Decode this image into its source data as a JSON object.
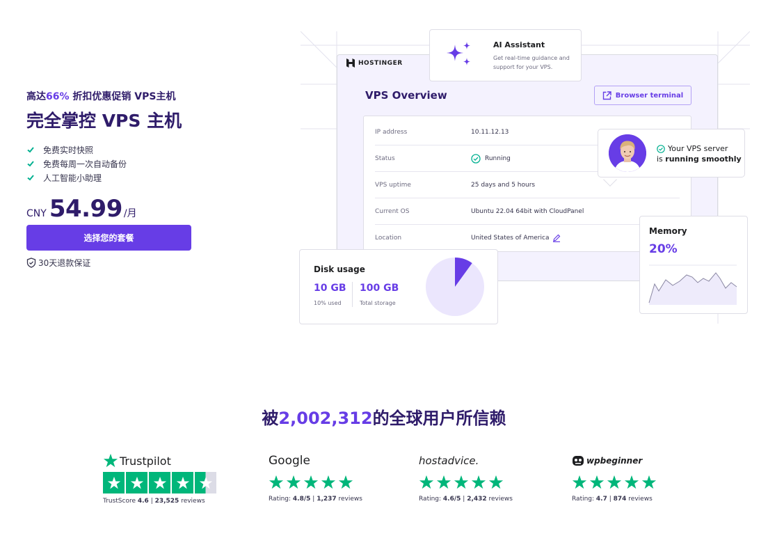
{
  "hero": {
    "promo_prefix": "高达",
    "promo_percent": "66%",
    "promo_suffix": " 折扣优惠促销 VPS主机",
    "title": "完全掌控 VPS 主机",
    "features": [
      "免费实时快照",
      "免费每周一次自动备份",
      "人工智能小助理"
    ],
    "currency": "CNY",
    "price": "54.99",
    "period": "/月",
    "cta_label": "选择您的套餐",
    "guarantee": "30天退款保证"
  },
  "illustration": {
    "brand": "HOSTINGER",
    "ai_title": "AI Assistant",
    "ai_desc": "Get real-time guidance and support for your VPS.",
    "vps_title": "VPS Overview",
    "terminal_button": "Browser terminal",
    "rows": [
      {
        "key": "IP address",
        "value": "10.11.12.13"
      },
      {
        "key": "Status",
        "value": "Running"
      },
      {
        "key": "VPS uptime",
        "value": "25 days and 5 hours"
      },
      {
        "key": "Current OS",
        "value": "Ubuntu 22.04 64bit with CloudPanel"
      },
      {
        "key": "Location",
        "value": "United States of America"
      }
    ],
    "status_line1": "Your VPS server",
    "status_is": "is ",
    "status_bold": "running smoothly",
    "memory_title": "Memory",
    "memory_value": "20%",
    "memory_fraction": 0.2,
    "disk_title": "Disk usage",
    "disk_used": "10 GB",
    "disk_used_label": "10% used",
    "disk_total": "100 GB",
    "disk_total_label": "Total storage",
    "disk_fraction": 0.1
  },
  "trust": {
    "prefix": "被",
    "count": "2,002,312",
    "suffix": "的全球用户所信赖"
  },
  "reviews": [
    {
      "logo": "Trustpilot",
      "score_label": "TrustScore ",
      "score": "4.6",
      "sep": " | ",
      "count": "23,525",
      "count_label": " reviews",
      "stars": 4.5
    },
    {
      "logo": "Google",
      "score_label": "Rating: ",
      "score": "4.8/5",
      "sep": " | ",
      "count": "1,237",
      "count_label": " reviews",
      "stars": 5
    },
    {
      "logo": "hostadvice.",
      "score_label": "Rating: ",
      "score": "4.6/5",
      "sep": " | ",
      "count": "2,432",
      "count_label": " reviews",
      "stars": 5
    },
    {
      "logo": "wpbeginner",
      "score_label": "Rating: ",
      "score": "4.7",
      "sep": " | ",
      "count": "874",
      "count_label": " reviews",
      "stars": 5
    }
  ],
  "colors": {
    "accent": "#673de6",
    "navy": "#2f1c6a",
    "green": "#00b67a"
  }
}
